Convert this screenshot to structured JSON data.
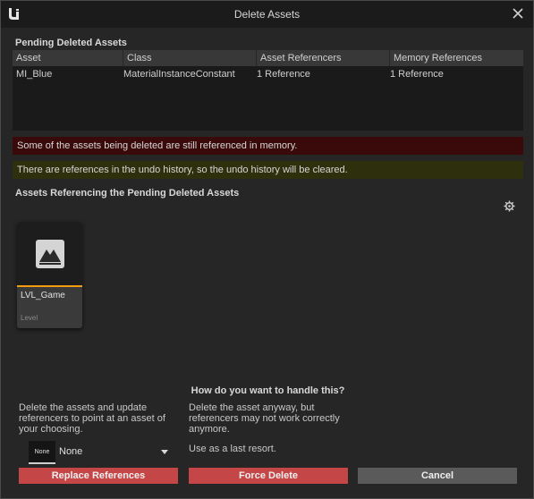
{
  "window": {
    "title": "Delete Assets"
  },
  "pending": {
    "heading": "Pending Deleted Assets",
    "columns": [
      "Asset",
      "Class",
      "Asset Referencers",
      "Memory References"
    ],
    "rows": [
      [
        "MI_Blue",
        "MaterialInstanceConstant",
        "1 Reference",
        "1 Reference"
      ]
    ]
  },
  "banners": {
    "error": "Some of the assets being deleted are still referenced in memory.",
    "warning": "There are references in the undo history, so the undo history will be cleared."
  },
  "referencing": {
    "heading": "Assets Referencing the Pending Deleted Assets",
    "assets": [
      {
        "name": "LVL_Game",
        "type": "Level"
      }
    ]
  },
  "handle": {
    "question": "How do you want to handle this?",
    "replace_desc": "Delete the assets and update referencers to point at an asset of your choosing.",
    "force_desc": "Delete the asset anyway, but referencers may not work correctly anymore.",
    "force_note": "Use as a last resort.",
    "dropdown_thumb": "None",
    "dropdown_value": "None"
  },
  "buttons": {
    "replace": "Replace References",
    "force": "Force Delete",
    "cancel": "Cancel"
  },
  "colors": {
    "error_bg": "#3a0a0a",
    "warning_bg": "#2e2f0c",
    "danger_button": "#c44646",
    "neutral_button": "#5a5a5a",
    "asset_accent": "#f39c12"
  },
  "icons": [
    "unreal-logo-icon",
    "close-icon",
    "settings-gear-icon",
    "level-asset-icon",
    "chevron-down-icon"
  ]
}
